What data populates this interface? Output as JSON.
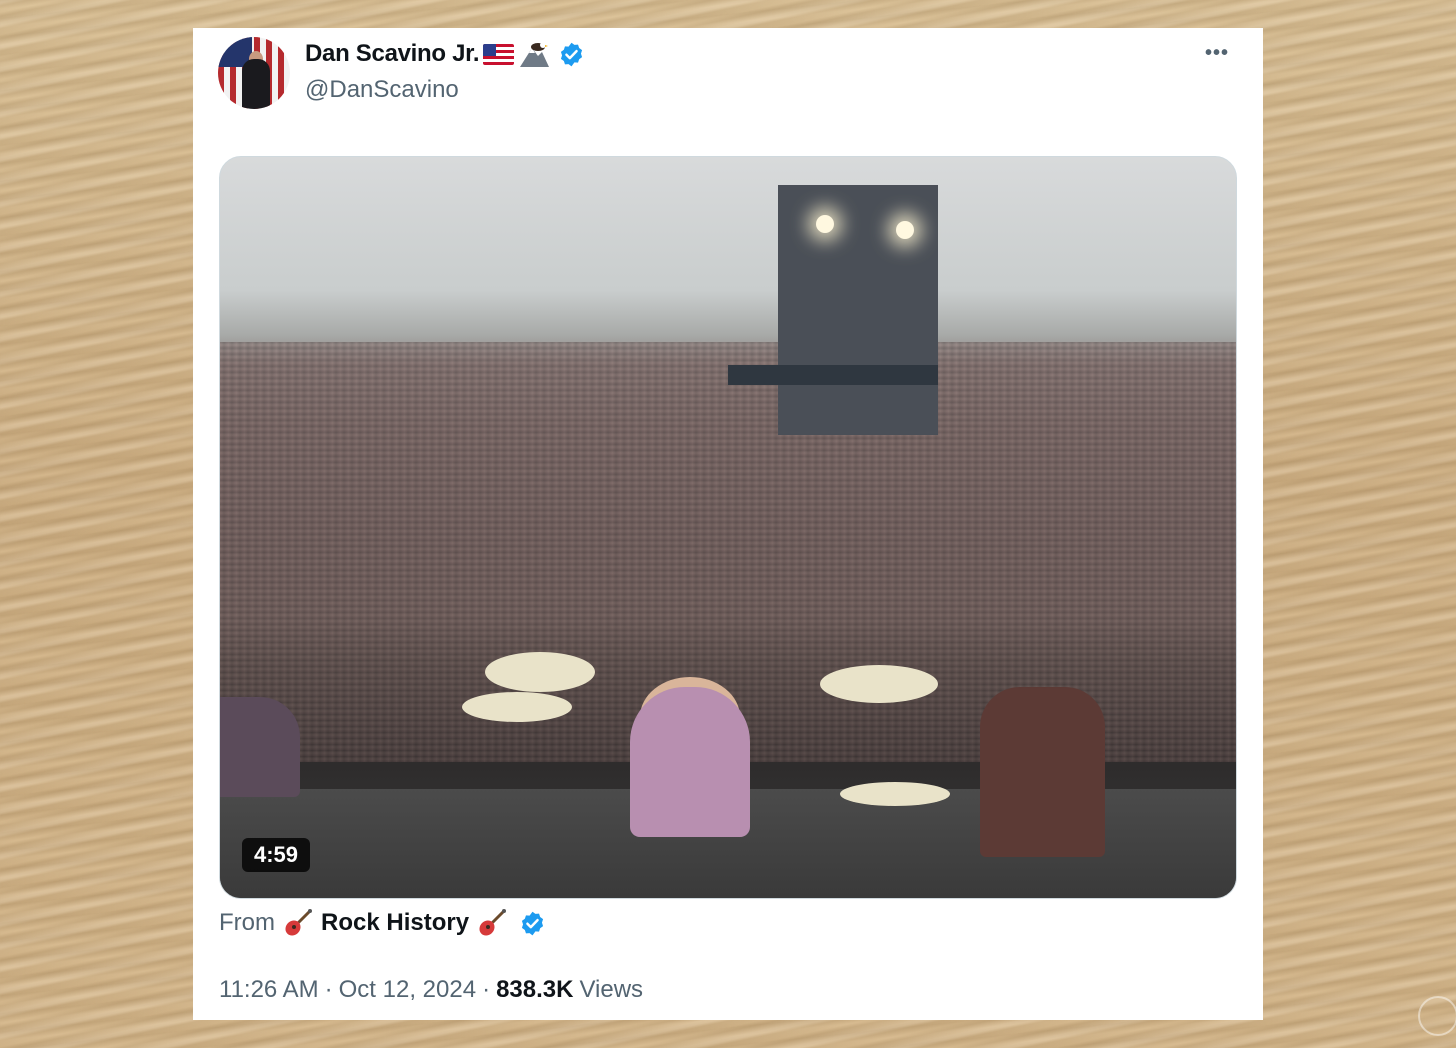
{
  "tweet": {
    "display_name": "Dan Scavino Jr.",
    "name_emojis": [
      "us-flag-emoji",
      "eagle-mountain-emoji"
    ],
    "handle": "@DanScavino",
    "verified": true,
    "more_label": "•••",
    "video": {
      "duration": "4:59",
      "description_icon": "concert-crowd-video-thumbnail"
    },
    "from_label": "From",
    "source_name": "Rock History",
    "source_emoji": "guitar-emoji",
    "source_verified": true,
    "time": "11:26 AM",
    "separator": "·",
    "date": "Oct 12, 2024",
    "views_count": "838.3K",
    "views_label": "Views"
  },
  "colors": {
    "verified_blue": "#1d9bf0",
    "text_primary": "#0f1419",
    "text_secondary": "#536471",
    "card_bg": "#ffffff"
  }
}
